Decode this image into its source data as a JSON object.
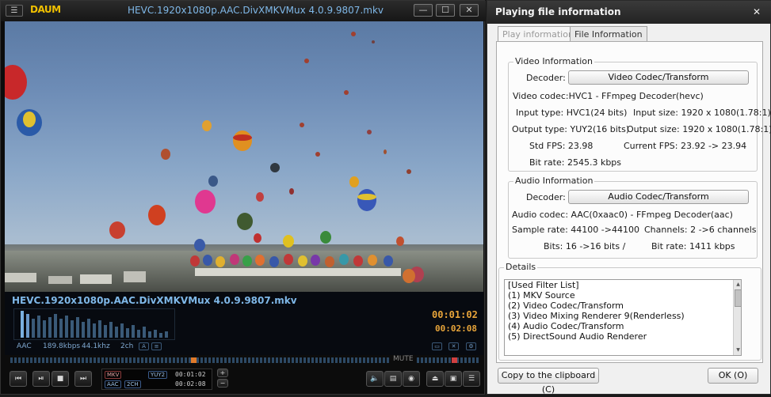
{
  "player": {
    "menu_label": "☰",
    "logo": "DAUM",
    "title": "HEVC.1920x1080p.AAC.DivXMKVMux 4.0.9.9807.mkv",
    "minimize": "—",
    "maximize": "☐",
    "close": "✕",
    "file_name": "HEVC.1920x1080p.AAC.DivXMKVMux 4.0.9.9807.mkv",
    "audio_codec": "AAC",
    "audio_bitrate": "189.8kbps",
    "audio_samplerate": "44.1khz",
    "audio_channels": "2ch",
    "time_elapsed": "00:01:02",
    "time_total": "00:02:08",
    "mute_label": "MUTE",
    "status": {
      "container": "MKV",
      "video_fmt": "YUY2",
      "audio_fmt": "AAC",
      "channels": "2CH",
      "time_elapsed": "00:01:02",
      "time_total": "00:02:08"
    },
    "buttons": {
      "prev": "⏮",
      "play_pause": "⏯",
      "stop": "■",
      "next": "⏭"
    },
    "icons": {
      "menu": "menu-icon",
      "prev": "skip-back-icon",
      "play": "play-pause-icon",
      "stop": "stop-icon",
      "next": "skip-forward-icon",
      "volume": "speaker-icon",
      "subtitle": "subtitle-icon",
      "eject": "eject-icon"
    }
  },
  "dialog": {
    "title": "Playing file information",
    "close": "✕",
    "tabs": [
      "Play information",
      "File Information"
    ],
    "video": {
      "legend": "Video Information",
      "decoder_label": "Decoder:",
      "decoder_button": "Video Codec/Transform",
      "codec": "Video codec:HVC1 - FFmpeg Decoder(hevc)",
      "input_type": "Input type: HVC1(24 bits)",
      "input_size": "Input size: 1920 x 1080(1.78:1)",
      "output_type": "Output type: YUY2(16 bits)",
      "output_size": "Output size: 1920 x 1080(1.78:1)",
      "std_fps": "Std FPS: 23.98",
      "current_fps": "Current FPS: 23.92 -> 23.94",
      "bitrate": "Bit rate: 2545.3 kbps"
    },
    "audio": {
      "legend": "Audio Information",
      "decoder_label": "Decoder:",
      "decoder_button": "Audio Codec/Transform",
      "codec": "Audio codec: AAC(0xaac0) - FFmpeg Decoder(aac)",
      "sample_rate": "Sample rate: 44100 ->44100",
      "channels": "Channels: 2 ->6 channels",
      "bits": "Bits: 16 ->16 bits /",
      "bitrate": "Bit rate: 1411 kbps"
    },
    "details": {
      "legend": "Details",
      "lines": [
        "[Used Filter List]",
        "(1) MKV Source",
        "(2) Video Codec/Transform",
        "(3) Video Mixing Renderer 9(Renderless)",
        "(4) Audio Codec/Transform",
        "(5) DirectSound Audio Renderer"
      ]
    },
    "copy_button": "Copy to the clipboard (C)",
    "ok_button": "OK (O)"
  }
}
